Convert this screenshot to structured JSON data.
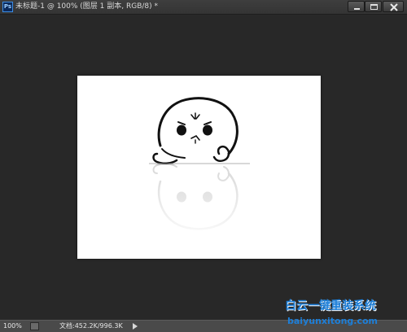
{
  "titlebar": {
    "app_icon_label": "Ps",
    "document_title": "未标题-1 @ 100% (图层 1 副本, RGB/8) *"
  },
  "window_controls": {
    "minimize_icon": "minimize-icon",
    "maximize_icon": "maximize-icon",
    "close_icon": "close-icon"
  },
  "statusbar": {
    "zoom": "100%",
    "doc_info": "文档:452.2K/996.3K"
  },
  "watermark": {
    "brand_cn": "白云一键重装系统",
    "url": "baiyunxitong.com",
    "color": "#1d7fd9"
  },
  "colors": {
    "workspace_bg": "#282828",
    "canvas_bg": "#ffffff",
    "statusbar_bg": "#4a4a4a"
  }
}
